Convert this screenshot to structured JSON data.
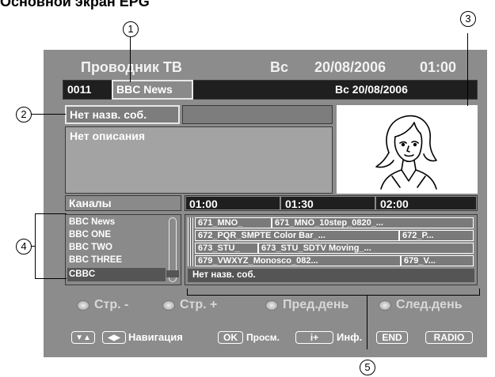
{
  "page": {
    "heading": "Основной экран EPG"
  },
  "callouts": [
    "1",
    "2",
    "3",
    "4",
    "5"
  ],
  "tv": {
    "title": "Проводник ТВ",
    "day": "Вс",
    "date": "20/08/2006",
    "time": "01:00"
  },
  "channel_bar": {
    "number": "0011",
    "name": "BBC News",
    "date": "Вс  20/08/2006"
  },
  "event": {
    "title": "Нет назв. соб.",
    "description": "Нет описания"
  },
  "channels": {
    "header": "Каналы",
    "items": [
      "BBC News",
      "BBC ONE",
      "BBC TWO",
      "BBC THREE",
      "CBBC"
    ]
  },
  "timeline": {
    "slots": [
      "01:00",
      "01:30",
      "02:00"
    ]
  },
  "programs": [
    {
      "cells": [
        "671_MNO_",
        "671_MNO_10step_0820_..."
      ]
    },
    {
      "cells": [
        "672_PQR_SMPTE Color Bar_...",
        "672_P..."
      ]
    },
    {
      "cells": [
        "673_STU_",
        "673_STU_SDTV Moving_..."
      ]
    },
    {
      "cells": [
        "679_VWXYZ_Monosco_082...",
        "679_V..."
      ]
    }
  ],
  "grid_status": "Нет назв. соб.",
  "color_buttons": [
    "Стр. -",
    "Стр. +",
    "Пред.день",
    "След.день"
  ],
  "nav": {
    "arrows_ud": "▼▲",
    "arrows_lr": "◀▶",
    "nav_label": "Навигация",
    "ok_key": "OK",
    "view_label": "Просм.",
    "info_key": "i+",
    "info_label": "Инф.",
    "end_key": "END",
    "radio_key": "RADIO"
  }
}
